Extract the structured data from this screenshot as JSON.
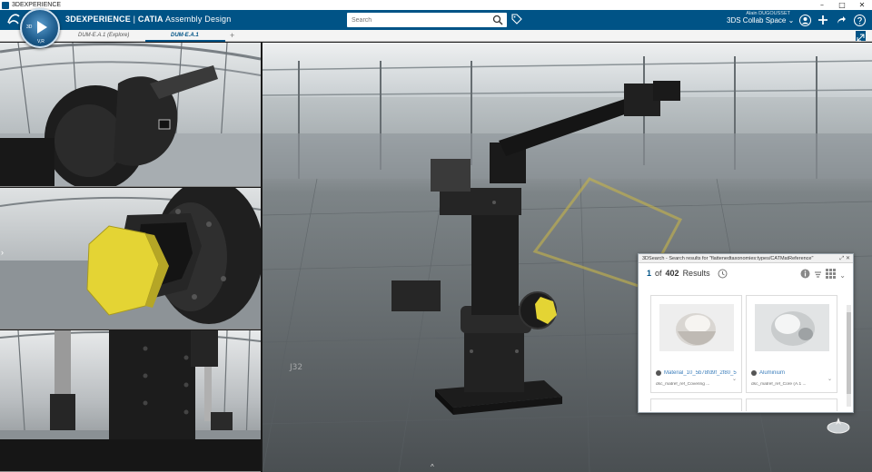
{
  "os_window": {
    "title": "3DEXPERIENCE",
    "controls": [
      "–",
      "□",
      "✕"
    ]
  },
  "app_bar": {
    "compass_label_left": "3D",
    "compass_label_right": "V,R",
    "brand": "3DEXPERIENCE",
    "separator": " | ",
    "product": "CATIA",
    "app_name": "Assembly Design",
    "search_placeholder": "Search",
    "user_name": "Alain DUGOUSSET",
    "collab_space": "3DS Collab Space"
  },
  "tabs": [
    {
      "label": "DUM-E.A.1 (Explore)",
      "active": false
    },
    {
      "label": "DUM-E.A.1",
      "active": true
    }
  ],
  "tab_add": "+",
  "search_panel": {
    "title": "3DSearch - Search results for \"flattenedtaxonomies:types/CATMatReference\"",
    "current": "1",
    "of_label": "of",
    "total": "402",
    "results_label": "Results",
    "cards": [
      {
        "name": "Material_10_5b78fd9f_2f80_5",
        "type": "dsc_matref_ref_Covering ..."
      },
      {
        "name": "Aluminium",
        "type": "dsc_matref_ref_Core (A.1 ..."
      }
    ]
  },
  "colors": {
    "app_bar": "#005386",
    "accent": "#3a7dbb",
    "knob": "#e4d434"
  }
}
